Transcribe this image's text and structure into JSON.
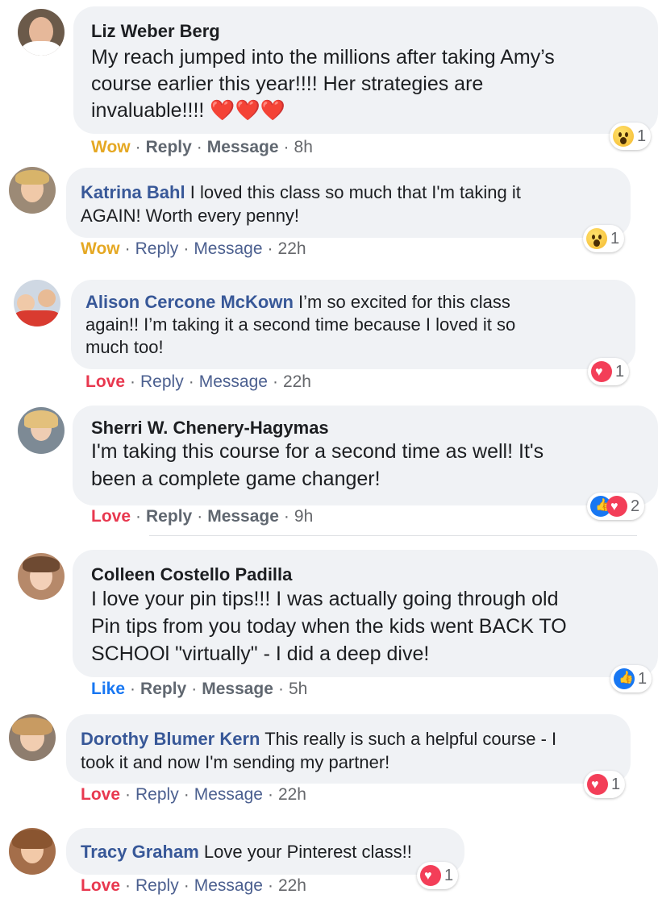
{
  "separators": {
    "dot": "·"
  },
  "comments": [
    {
      "name": "Liz Weber Berg",
      "text_lines": [
        "My reach jumped into the millions after taking Amy’s",
        "course earlier this year!!!! Her strategies are",
        "invaluable!!!! ❤️❤️❤️"
      ],
      "reaction_label": "Wow",
      "reply": "Reply",
      "message": "Message",
      "time": "8h",
      "badge_count": "1",
      "badge_icons": [
        "wow-icon"
      ]
    },
    {
      "name": "Katrina Bahl",
      "text_lines": [
        "I loved this class so much that I'm taking it",
        "AGAIN! Worth every penny!"
      ],
      "reaction_label": "Wow",
      "reply": "Reply",
      "message": "Message",
      "time": "22h",
      "badge_count": "1",
      "badge_icons": [
        "wow-icon"
      ]
    },
    {
      "name": "Alison Cercone McKown",
      "text_lines": [
        "I’m so excited for this class",
        "again!! I’m taking it a second time because I loved it so",
        "much too!"
      ],
      "reaction_label": "Love",
      "reply": "Reply",
      "message": "Message",
      "time": "22h",
      "badge_count": "1",
      "badge_icons": [
        "love-icon"
      ]
    },
    {
      "name": "Sherri W. Chenery-Hagymas",
      "text_lines": [
        "I'm taking this course for a second time as well! It's",
        "been a complete game changer!"
      ],
      "reaction_label": "Love",
      "reply": "Reply",
      "message": "Message",
      "time": "9h",
      "badge_count": "2",
      "badge_icons": [
        "like-icon",
        "love-icon"
      ]
    },
    {
      "name": "Colleen Costello Padilla",
      "text_lines": [
        "I love your pin tips!!! I was actually going through old",
        "Pin tips from you today when the kids went BACK TO",
        "SCHOOl \"virtually\" - I did a deep dive!"
      ],
      "reaction_label": "Like",
      "reply": "Reply",
      "message": "Message",
      "time": "5h",
      "badge_count": "1",
      "badge_icons": [
        "like-icon"
      ]
    },
    {
      "name": "Dorothy Blumer Kern",
      "text_lines": [
        "This really is such a helpful course - I",
        "took it and now I'm sending my partner!"
      ],
      "reaction_label": "Love",
      "reply": "Reply",
      "message": "Message",
      "time": "22h",
      "badge_count": "1",
      "badge_icons": [
        "love-icon"
      ]
    },
    {
      "name": "Tracy Graham",
      "text_lines": [
        "Love your Pinterest class!!"
      ],
      "reaction_label": "Love",
      "reply": "Reply",
      "message": "Message",
      "time": "22h",
      "badge_count": "1",
      "badge_icons": [
        "love-icon"
      ]
    }
  ],
  "colors": {
    "bubble": "#f0f2f5",
    "name_link": "#385898",
    "wow": "#e5a823",
    "love": "#e8384f",
    "like": "#1877f2"
  }
}
